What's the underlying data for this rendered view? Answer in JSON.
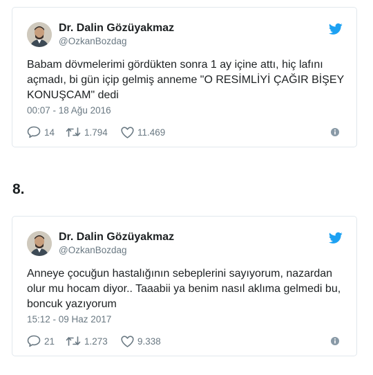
{
  "tweets": [
    {
      "display_name": "Dr. Dalin Gözüyakmaz",
      "handle": "@OzkanBozdag",
      "text": "Babam dövmelerimi gördükten sonra 1 ay içine attı, hiç lafını açmadı, bi gün içip gelmiş anneme \"O RESİMLİYİ ÇAĞIR BİŞEY KONUŞCAM\" dedi",
      "timestamp": "00:07 - 18 Ağu 2016",
      "replies": "14",
      "retweets": "1.794",
      "likes": "11.469"
    },
    {
      "display_name": "Dr. Dalin Gözüyakmaz",
      "handle": "@OzkanBozdag",
      "text": "Anneye çocuğun hastalığının sebeplerini sayıyorum, nazardan olur mu hocam diyor.. Taaabii ya benim nasıl aklıma gelmedi bu, boncuk yazıyorum",
      "timestamp": "15:12 - 09 Haz 2017",
      "replies": "21",
      "retweets": "1.273",
      "likes": "9.338"
    }
  ],
  "list_number": "8.",
  "colors": {
    "twitter_blue": "#1da1f2",
    "meta_gray": "#697882",
    "border": "#e1e8ed"
  },
  "icons": [
    "avatar",
    "twitter-bird-icon",
    "reply-icon",
    "retweet-icon",
    "heart-icon",
    "info-icon"
  ]
}
